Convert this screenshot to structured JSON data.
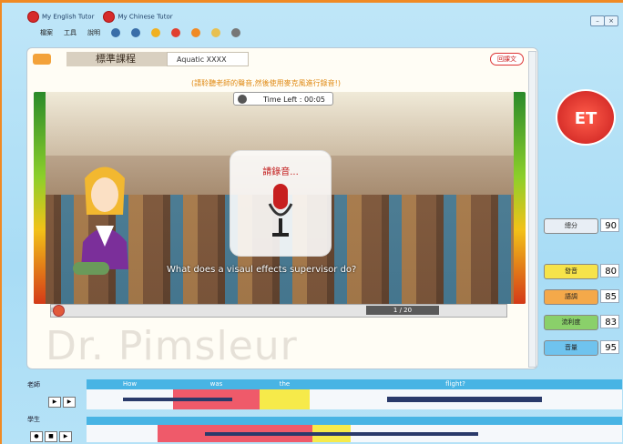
{
  "topbar": {
    "english_tutor": "My English Tutor",
    "chinese_tutor": "My Chinese Tutor"
  },
  "menu": {
    "file": "檔案",
    "tools": "工具",
    "help": "說明"
  },
  "lesson": {
    "tab_title": "標準課程",
    "course": "Aquatic XXXX",
    "back_label": "回課文",
    "instruction": "(請聆聽老師的聲音,然後使用麥克風進行錄音!)",
    "time_left": "Time Left : 00:05",
    "record_prompt": "請錄音...",
    "question": "What does a visaul effects supervisor do?",
    "counter": "1 / 20",
    "progress": 0.02,
    "watermark": "Dr. Pimsleur"
  },
  "badge": {
    "text": "ET"
  },
  "scores": [
    {
      "label": "總分",
      "value": "90",
      "color": "#e8eef5"
    },
    {
      "label": "發音",
      "value": "80",
      "color": "#f6e34a"
    },
    {
      "label": "語調",
      "value": "85",
      "color": "#f4a94a"
    },
    {
      "label": "流利度",
      "value": "83",
      "color": "#8ad06a"
    },
    {
      "label": "音量",
      "value": "95",
      "color": "#6fc3ee"
    }
  ],
  "waveform": {
    "teacher_label": "老師",
    "student_label": "學生",
    "words": [
      "How",
      "was",
      "the",
      "flight?"
    ]
  }
}
